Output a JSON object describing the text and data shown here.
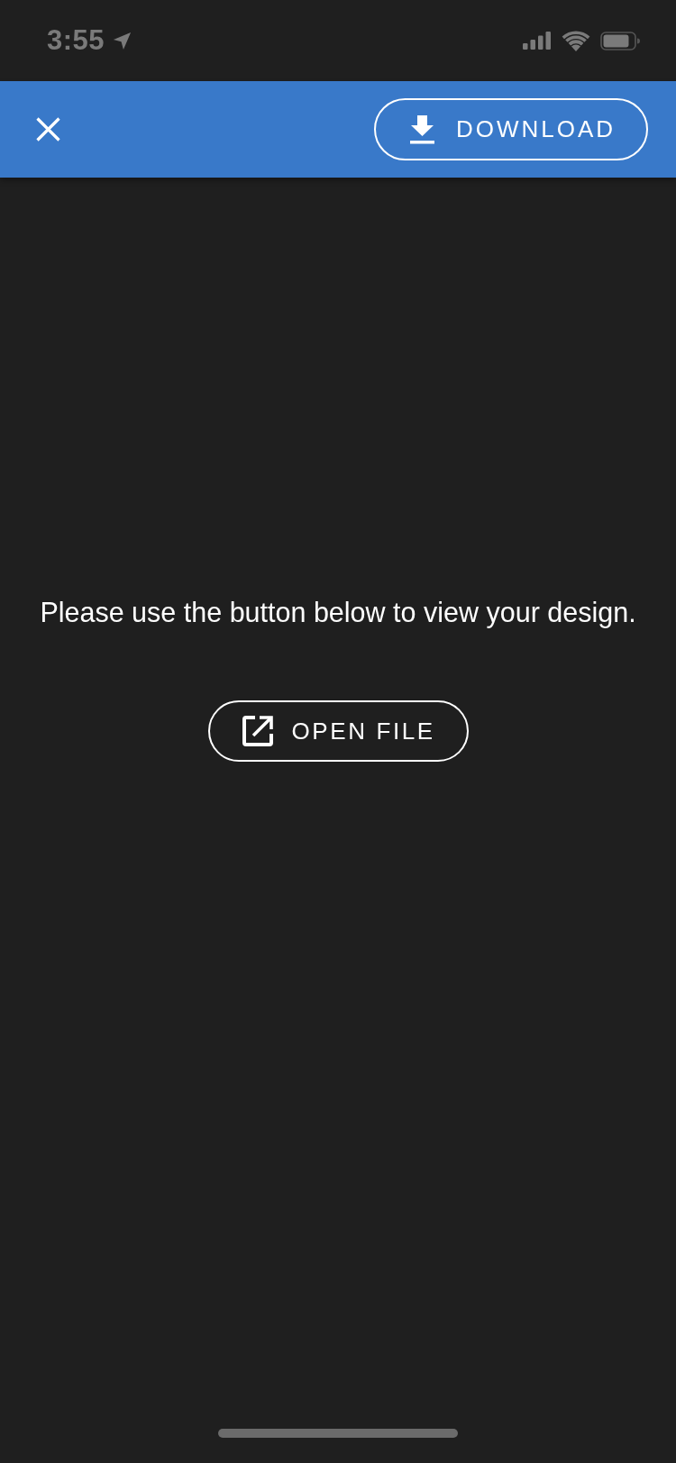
{
  "status_bar": {
    "time": "3:55"
  },
  "header": {
    "download_button": {
      "label": "DOWNLOAD"
    }
  },
  "content": {
    "message": "Please use the button below to view your design.",
    "open_button": {
      "label": "OPEN FILE"
    }
  }
}
